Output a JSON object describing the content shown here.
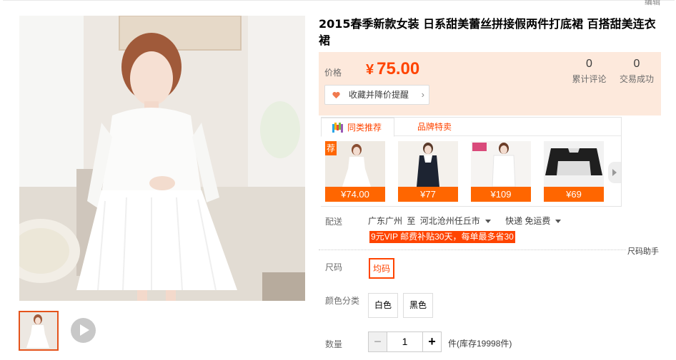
{
  "top": {
    "edit_label": "编辑"
  },
  "product": {
    "title": "2015春季新款女装 日系甜美蕾丝拼接假两件打底裙 百搭甜美连衣裙"
  },
  "price": {
    "label": "价格",
    "currency": "¥",
    "value": "75.00",
    "reviews_count": "0",
    "reviews_label": "累计评论",
    "sales_count": "0",
    "sales_label": "交易成功",
    "favorite_button": "收藏并降价提醒"
  },
  "recommend": {
    "tab_similar": "同类推荐",
    "tab_brand": "品牌特卖",
    "badge": "荐",
    "items": [
      {
        "price": "¥74.00"
      },
      {
        "price": "¥77"
      },
      {
        "price": "¥109"
      },
      {
        "price": "¥69"
      }
    ]
  },
  "delivery": {
    "label": "配送",
    "from": "广东广州",
    "to_word": "至",
    "to": "河北沧州任丘市",
    "method": "快递 免运费",
    "vip_note": "9元VIP 邮费补贴30天，每单最多省30"
  },
  "size": {
    "label": "尺码",
    "helper": "尺码助手",
    "options": [
      "均码"
    ]
  },
  "color": {
    "label": "颜色分类",
    "options": [
      "白色",
      "黑色"
    ]
  },
  "quantity": {
    "label": "数量",
    "minus": "−",
    "value": "1",
    "plus": "+",
    "stock_text": "件(库存19998件)"
  },
  "colors": {
    "accent": "#ff4400",
    "price_bg": "#fde9dc",
    "thumb_border": "#e4531b"
  }
}
